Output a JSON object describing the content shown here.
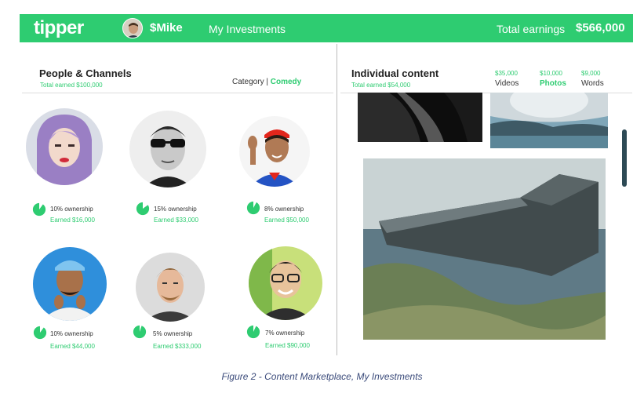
{
  "header": {
    "logo": "tipper",
    "username": "$Mike",
    "nav_item": "My Investments",
    "total_earnings_label": "Total earnings",
    "total_earnings_value": "$566,000"
  },
  "people_panel": {
    "title": "People & Channels",
    "subtitle": "Total earned $100,000",
    "category_label": "Category",
    "category_separator": "|",
    "category_value": "Comedy",
    "people": [
      {
        "ownership": "10% ownership",
        "earned": "Earned $16,000",
        "ownership_fraction": 0.1
      },
      {
        "ownership": "15%  ownership",
        "earned": "Earned $33,000",
        "ownership_fraction": 0.15
      },
      {
        "ownership": "8% ownership",
        "earned": "Earned $50,000",
        "ownership_fraction": 0.08
      },
      {
        "ownership": "10%  ownership",
        "earned": "Earned $44,000",
        "ownership_fraction": 0.1
      },
      {
        "ownership": "5% ownership",
        "earned": "Earned $333,000",
        "ownership_fraction": 0.05
      },
      {
        "ownership": "7% ownership",
        "earned": "Earned $90,000",
        "ownership_fraction": 0.07
      }
    ]
  },
  "content_panel": {
    "title": "Individual content",
    "subtitle": "Total earned $54,000",
    "tabs": [
      {
        "amount": "$35,000",
        "label": "Videos",
        "active": false
      },
      {
        "amount": "$10,000",
        "label": "Photos",
        "active": true
      },
      {
        "amount": "$9,000",
        "label": "Words",
        "active": false
      }
    ]
  },
  "caption": "Figure 2 - Content Marketplace, My Investments",
  "colors": {
    "brand_green": "#2ecc71",
    "scrollbar": "#2d4a55",
    "caption_text": "#3a4a7a"
  }
}
